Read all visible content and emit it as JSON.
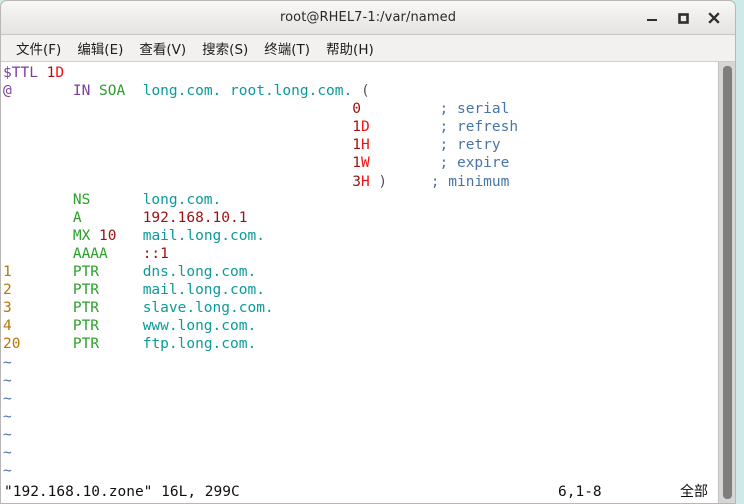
{
  "window": {
    "title": "root@RHEL7-1:/var/named",
    "controls": [
      {
        "name": "minimize-button",
        "label": "–"
      },
      {
        "name": "maximize-button",
        "label": "■"
      },
      {
        "name": "close-button",
        "label": "✕"
      }
    ]
  },
  "menubar": {
    "items": [
      {
        "label": "文件(F)"
      },
      {
        "label": "编辑(E)"
      },
      {
        "label": "查看(V)"
      },
      {
        "label": "搜索(S)"
      },
      {
        "label": "终端(T)"
      },
      {
        "label": "帮助(H)"
      }
    ]
  },
  "editor": {
    "application": "vim",
    "file_lines": [
      {
        "n": 1,
        "text": "$TTL 1D"
      },
      {
        "n": 2,
        "text": "@\tIN SOA\tlong.com. root.long.com. ("
      },
      {
        "n": 3,
        "text": "\t\t\t\t\t0\t; serial"
      },
      {
        "n": 4,
        "text": "\t\t\t\t\t1D\t; refresh"
      },
      {
        "n": 5,
        "text": "\t\t\t\t\t1H\t; retry"
      },
      {
        "n": 6,
        "text": "\t\t\t\t\t1W\t; expire"
      },
      {
        "n": 7,
        "text": "\t\t\t\t\t3H )\t; minimum"
      },
      {
        "n": 8,
        "text": "\tNS\tlong.com."
      },
      {
        "n": 9,
        "text": "\tA\t192.168.10.1"
      },
      {
        "n": 10,
        "text": "\tMX 10\tmail.long.com."
      },
      {
        "n": 11,
        "text": "\tAAAA\t::1"
      },
      {
        "n": 12,
        "text": "1\tPTR\tdns.long.com."
      },
      {
        "n": 13,
        "text": "2\tPTR\tmail.long.com."
      },
      {
        "n": 14,
        "text": "3\tPTR\tslave.long.com."
      },
      {
        "n": 15,
        "text": "4\tPTR\twww.long.com."
      },
      {
        "n": 16,
        "text": "20\tPTR\tftp.long.com."
      }
    ],
    "tokens": {
      "ttl_directive": "$TTL",
      "ttl_value_num": "1",
      "ttl_value_unit": "D",
      "origin": "@",
      "class_in": "IN",
      "rr_soa": "SOA",
      "soa_mname": "long.com.",
      "soa_rname": "root.long.com.",
      "open_paren": "(",
      "close_paren": ")",
      "serial_value": "0",
      "serial_comment": "; serial",
      "refresh_num": "1",
      "refresh_unit": "D",
      "refresh_comment": "; refresh",
      "retry_num": "1",
      "retry_unit": "H",
      "retry_comment": "; retry",
      "expire_num": "1",
      "expire_unit": "W",
      "expire_comment": "; expire",
      "minimum_num": "3",
      "minimum_unit": "H",
      "minimum_comment": "; minimum",
      "rr_ns": "NS",
      "ns_target": "long.com.",
      "rr_a": "A",
      "a_address": "192.168.10.1",
      "rr_mx": "MX",
      "mx_priority": "10",
      "mx_target": "mail.long.com.",
      "rr_aaaa": "AAAA",
      "aaaa_address": "::1",
      "rr_ptr": "PTR",
      "ptr_records": [
        {
          "index": "1",
          "target": "dns.long.com."
        },
        {
          "index": "2",
          "target": "mail.long.com."
        },
        {
          "index": "3",
          "target": "slave.long.com."
        },
        {
          "index": "4",
          "target": "www.long.com."
        },
        {
          "index": "20",
          "target": "ftp.long.com."
        }
      ]
    },
    "empty_marker": "~",
    "empty_marker_count": 7,
    "statusline": {
      "file_info": "\"192.168.10.zone\" 16L, 299C",
      "cursor_position": "6,1-8",
      "scroll_indicator": "全部"
    }
  },
  "colors": {
    "desktop_background": "#cdeae8",
    "window_chrome": "#f6f5f4",
    "terminal_background": "#ffffff",
    "directive_purple": "#7b3f9d",
    "record_type_green": "#2aa02a",
    "hostname_teal": "#0c9a9a",
    "number_dark_red": "#9c1111",
    "unit_bright_red": "#ee1111",
    "comment_blue": "#4a74a8",
    "ptr_index_orange": "#b5760b",
    "scrollbar_thumb": "#7e7e7e"
  }
}
